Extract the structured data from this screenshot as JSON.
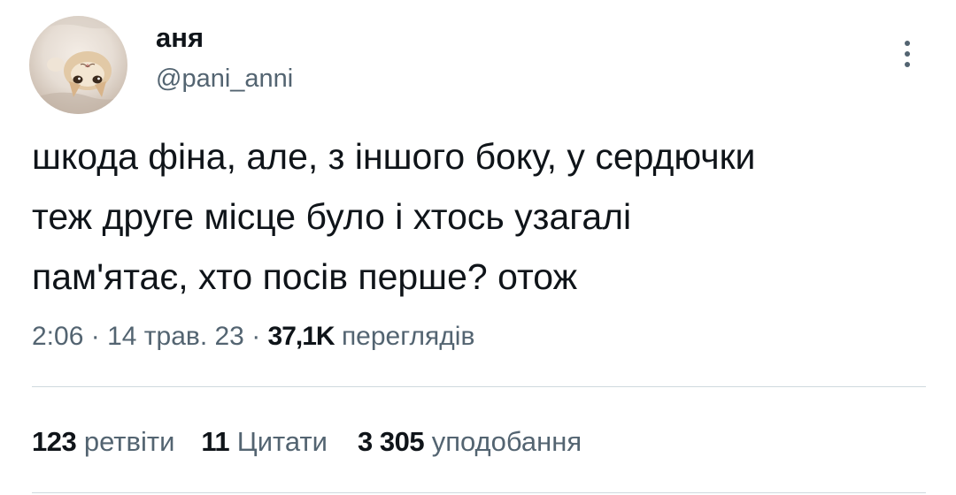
{
  "author": {
    "display_name": "аня",
    "handle": "@pani_anni",
    "avatar_icon": "cat-photo-avatar"
  },
  "menu": {
    "icon": "more-vertical-icon"
  },
  "tweet": {
    "text": "шкода фіна, але, з іншого боку, у сердючки\nтеж друге місце було і хтось узагалі\nпам'ятає, хто посів перше? отож"
  },
  "meta": {
    "time": "2:06",
    "sep1": " · ",
    "date": "14 трав. 23",
    "sep2": " · ",
    "views_count": "37,1K",
    "views_label": "переглядів"
  },
  "stats": {
    "retweets_count": "123",
    "retweets_label": "ретвіти",
    "quotes_count": "11",
    "quotes_label": "Цитати",
    "likes_count": "3 305",
    "likes_label": "уподобання"
  },
  "colors": {
    "text_primary": "#0f1419",
    "text_secondary": "#536471",
    "divider": "#cfd9de",
    "background": "#ffffff"
  }
}
